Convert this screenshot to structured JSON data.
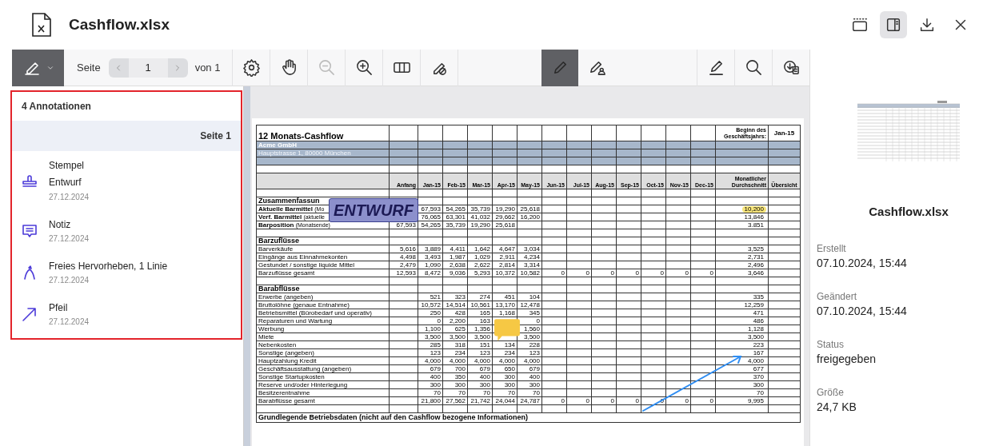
{
  "window": {
    "title": "Cashflow.xlsx"
  },
  "header_buttons": [
    {
      "kind": "toolbar",
      "selected": false
    },
    {
      "kind": "sidebar",
      "selected": true
    },
    {
      "kind": "download",
      "selected": false
    },
    {
      "kind": "close",
      "selected": false
    }
  ],
  "toolbar": {
    "mode": {
      "kind": "annotate",
      "selected": true
    },
    "page_label": "Seite",
    "page_value": "1",
    "page_total": "von 1",
    "view_tools": [
      {
        "kind": "settings",
        "disabled": false
      },
      {
        "kind": "pan",
        "disabled": false
      },
      {
        "kind": "zoom-out",
        "disabled": true
      },
      {
        "kind": "zoom-in",
        "disabled": false
      },
      {
        "kind": "columns",
        "disabled": false
      },
      {
        "kind": "hide-annotations",
        "disabled": false
      }
    ],
    "draw_tools": [
      {
        "kind": "pencil",
        "selected": true
      },
      {
        "kind": "pen-user",
        "selected": false
      }
    ],
    "action_tools": [
      {
        "kind": "sign",
        "disabled": false
      },
      {
        "kind": "search",
        "disabled": false
      },
      {
        "kind": "export",
        "disabled": false
      }
    ]
  },
  "annotations": {
    "outlined": true,
    "count_label": "4 Annotationen",
    "page_group": "Seite 1",
    "items": [
      {
        "kind": "stamp",
        "title": "Stempel",
        "subtitle": "Entwurf",
        "date": "27.12.2024"
      },
      {
        "kind": "note",
        "title": "Notiz",
        "date": "27.12.2024"
      },
      {
        "kind": "ink",
        "title": "Freies Hervorheben, 1 Linie",
        "date": "27.12.2024"
      },
      {
        "kind": "arrow",
        "title": "Pfeil",
        "date": "27.12.2024"
      }
    ]
  },
  "document": {
    "stamp_text": "ENTWURF",
    "columns": [
      "Anfang",
      "Jan-15",
      "Feb-15",
      "Mar-15",
      "Apr-15",
      "May-15",
      "Jun-15",
      "Jul-15",
      "Aug-15",
      "Sep-15",
      "Oct-15",
      "Nov-15",
      "Dec-15",
      "Monatlicher Durchschnitt",
      "Übersicht"
    ],
    "rows": [
      {
        "kind": "title",
        "label": "12 Monats-Cashflow",
        "average": "Beginn des Geschäftsjahrs:",
        "overview": "Jan-15"
      },
      {
        "kind": "band",
        "label": "Acme GmbH"
      },
      {
        "kind": "band",
        "label": "Hauptstrasse 1, 80000 München"
      },
      {
        "kind": "band"
      },
      {
        "kind": "blank"
      },
      {
        "kind": "header"
      },
      {
        "kind": "blank"
      },
      {
        "kind": "section",
        "label": "Zusammenfassun"
      },
      {
        "kind": "data",
        "label": "Aktuelle Barmittel",
        "note": "(Mo",
        "bold": true,
        "highlighted": true,
        "months": [
          "67,593",
          "54,265",
          "35,739",
          "19,290",
          "25,618"
        ],
        "average": "10,200"
      },
      {
        "kind": "data",
        "label": "Verf. Barmittel",
        "note": "(aktuelle",
        "bold": true,
        "highlighted": false,
        "months": [
          "76,065",
          "63,301",
          "41,032",
          "29,662",
          "16,200"
        ],
        "average": "13,846"
      },
      {
        "kind": "data",
        "label": "Barposition",
        "note": "(Monatsende)",
        "bold": true,
        "highlighted": false,
        "anfang": "67,593",
        "months": [
          "54,265",
          "35,739",
          "19,290",
          "25,618"
        ],
        "average": "3.851"
      },
      {
        "kind": "blank"
      },
      {
        "kind": "section",
        "label": "Barzuflüsse"
      },
      {
        "kind": "data",
        "label": "Barverkäufe",
        "bold": false,
        "highlighted": false,
        "anfang": "5,616",
        "months": [
          "3,889",
          "4,411",
          "1,642",
          "4,647",
          "3,034"
        ],
        "average": "3,525"
      },
      {
        "kind": "data",
        "label": "Eingänge aus Einnahmekonten",
        "bold": false,
        "highlighted": false,
        "anfang": "4,498",
        "months": [
          "3,493",
          "1,987",
          "1,029",
          "2,911",
          "4,234"
        ],
        "average": "2,731"
      },
      {
        "kind": "data",
        "label": "Gestundet / sonstige liquide Mittel",
        "bold": false,
        "highlighted": false,
        "anfang": "2,479",
        "months": [
          "1,090",
          "2,638",
          "2,622",
          "2,814",
          "3,314"
        ],
        "average": "2,496"
      },
      {
        "kind": "data",
        "label": "Barzuflüsse gesamt",
        "bold": false,
        "highlighted": false,
        "anfang": "12,593",
        "months": [
          "8,472",
          "9,036",
          "5,293",
          "10,372",
          "10,582",
          "0",
          "0",
          "0",
          "0",
          "0",
          "0",
          "0"
        ],
        "average": "3,646"
      },
      {
        "kind": "blank"
      },
      {
        "kind": "section",
        "label": "Barabflüsse"
      },
      {
        "kind": "data",
        "label": "Erwerbe (angeben)",
        "bold": false,
        "highlighted": false,
        "months": [
          "521",
          "323",
          "274",
          "451",
          "104"
        ],
        "average": "335"
      },
      {
        "kind": "data",
        "label": "Bruttolöhne (genaue Entnahme)",
        "bold": false,
        "highlighted": false,
        "months": [
          "10,572",
          "14,514",
          "10,561",
          "13,170",
          "12,478"
        ],
        "average": "12,259"
      },
      {
        "kind": "data",
        "label": "Betriebsmittel (Bürobedarf und operativ)",
        "bold": false,
        "highlighted": false,
        "months": [
          "250",
          "428",
          "165",
          "1,168",
          "345"
        ],
        "average": "471"
      },
      {
        "kind": "data",
        "label": "Reparaturen und Wartung",
        "bold": false,
        "highlighted": false,
        "months": [
          "0",
          "2,200",
          "163"
        ],
        "months_after_note": [
          "0"
        ],
        "average": "486"
      },
      {
        "kind": "data",
        "label": "Werbung",
        "bold": false,
        "highlighted": false,
        "months": [
          "1,100",
          "625",
          "1,356"
        ],
        "months_after_note": [
          "1,560"
        ],
        "average": "1,128"
      },
      {
        "kind": "data",
        "label": "Miete",
        "bold": false,
        "highlighted": false,
        "months": [
          "3,500",
          "3,500",
          "3,500"
        ],
        "months_after_note": [
          "3,500"
        ],
        "average": "3,500"
      },
      {
        "kind": "data",
        "label": "Nebenkosten",
        "bold": false,
        "highlighted": false,
        "months": [
          "285",
          "318",
          "151",
          "134",
          "228"
        ],
        "average": "223"
      },
      {
        "kind": "data",
        "label": "Sonstige (angeben)",
        "bold": false,
        "highlighted": false,
        "months": [
          "123",
          "234",
          "123",
          "234",
          "123"
        ],
        "average": "167"
      },
      {
        "kind": "data",
        "label": "Hauptzahlung Kredit",
        "bold": false,
        "highlighted": false,
        "months": [
          "4,000",
          "4,000",
          "4,000",
          "4,000",
          "4,000"
        ],
        "average": "4,000"
      },
      {
        "kind": "data",
        "label": "Geschäftsausstattung (angeben)",
        "bold": false,
        "highlighted": false,
        "months": [
          "679",
          "700",
          "679",
          "650",
          "679"
        ],
        "average": "677"
      },
      {
        "kind": "data",
        "label": "Sonstige Startupkosten",
        "bold": false,
        "highlighted": false,
        "months": [
          "400",
          "350",
          "400",
          "300",
          "400"
        ],
        "average": "370"
      },
      {
        "kind": "data",
        "label": "Reserve und/oder Hinterlegung",
        "bold": false,
        "highlighted": false,
        "months": [
          "300",
          "300",
          "300",
          "300",
          "300"
        ],
        "average": "300"
      },
      {
        "kind": "data",
        "label": "Besitzerentnahme",
        "bold": false,
        "highlighted": false,
        "months": [
          "70",
          "70",
          "70",
          "70",
          "70"
        ],
        "average": "70"
      },
      {
        "kind": "data",
        "label": "Barabflüsse gesamt",
        "bold": false,
        "highlighted": false,
        "months": [
          "21,800",
          "27,562",
          "21,742",
          "24,044",
          "24,787",
          "0",
          "0",
          "0",
          "0",
          "0",
          "0",
          "0"
        ],
        "average": "9,995"
      },
      {
        "kind": "blank"
      },
      {
        "kind": "footer",
        "label": "Grundlegende Betriebsdaten (nicht auf den Cashflow bezogene Informationen)"
      }
    ]
  },
  "details": {
    "file_name": "Cashflow.xlsx",
    "fields": [
      {
        "label": "Erstellt",
        "value": "07.10.2024, 15:44"
      },
      {
        "label": "Geändert",
        "value": "07.10.2024, 15:44"
      },
      {
        "label": "Status",
        "value": "freigegeben"
      },
      {
        "label": "Größe",
        "value": "24,7 KB"
      }
    ]
  }
}
